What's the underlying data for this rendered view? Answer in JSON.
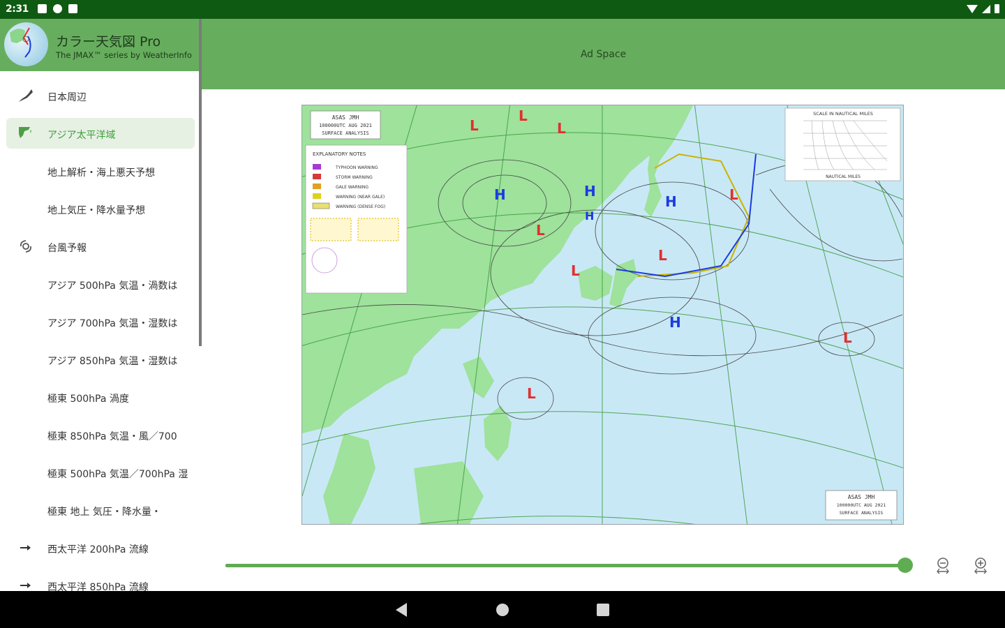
{
  "status": {
    "time": "2:31"
  },
  "drawer": {
    "app_title": "カラー天気図 Pro",
    "app_subtitle": "The JMAX™ series by WeatherInfo",
    "items": [
      {
        "label": "日本周辺",
        "icon": "japan-map-icon"
      },
      {
        "label": "アジア太平洋域",
        "icon": "asia-map-icon",
        "selected": true
      },
      {
        "label": "地上解析・海上悪天予想",
        "icon": ""
      },
      {
        "label": "地上気圧・降水量予想",
        "icon": ""
      },
      {
        "label": "台風予報",
        "icon": "typhoon-icon"
      },
      {
        "label": "アジア 500hPa 気温・渦数は",
        "icon": ""
      },
      {
        "label": "アジア 700hPa 気温・湿数は",
        "icon": ""
      },
      {
        "label": "アジア 850hPa 気温・湿数は",
        "icon": ""
      },
      {
        "label": "極東 500hPa 渦度",
        "icon": ""
      },
      {
        "label": "極東 850hPa 気温・風／700",
        "icon": ""
      },
      {
        "label": "極東 500hPa 気温／700hPa 湿",
        "icon": ""
      },
      {
        "label": "極東 地上 気圧・降水量・",
        "icon": ""
      },
      {
        "label": "西太平洋 200hPa 流線",
        "icon": "arrow-right-icon"
      },
      {
        "label": "西太平洋 850hPa 流線",
        "icon": "arrow-right-icon"
      }
    ]
  },
  "appbar": {
    "ad_label": "Ad Space"
  },
  "map": {
    "title_lines": [
      "ASAS JMH",
      "100000UTC AUG 2021",
      "SURFACE ANALYSIS"
    ],
    "notes_title": "EXPLANATORY NOTES",
    "notes": [
      "TYPHOON WARNING",
      "STORM WARNING",
      "GALE WARNING",
      "WARNING (NEAR GALE)",
      "WARNING (DENSE FOG)"
    ],
    "scale_title": "SCALE IN NAUTICAL MILES",
    "scale_xlabel": "NAUTICAL MILES",
    "low_label": "L",
    "high_label": "H"
  },
  "slider": {
    "value": 1.0
  },
  "colors": {
    "appbar": "#67ad5e",
    "statusbar": "#0f5a12",
    "accent": "#5fac53",
    "land": "#9ee29b",
    "sea": "#c9e8f6"
  }
}
